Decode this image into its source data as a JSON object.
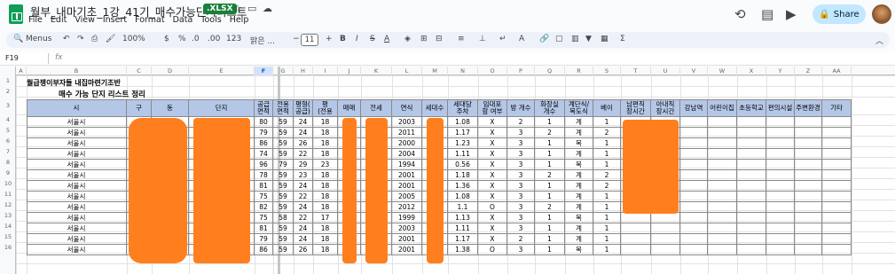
{
  "app": {
    "doc_title": "월부_내마기초_1강_41기_매수가능단지리스트",
    "file_badge": ".XLSX",
    "menu": [
      "File",
      "Edit",
      "View",
      "Insert",
      "Format",
      "Data",
      "Tools",
      "Help"
    ],
    "share_label": "Share"
  },
  "toolbar": {
    "menus_label": "Menus",
    "zoom": "100%",
    "currency": "$",
    "percent": "%",
    "dec_decrease": ".0",
    "dec_increase": ".00",
    "number_format": "123",
    "font_name": "맑은 ...",
    "font_size": "11",
    "bold": "B",
    "italic": "I",
    "strike": "S",
    "text_color": "A"
  },
  "formula_bar": {
    "name_box": "F19",
    "fx": "fx",
    "value": ""
  },
  "grid": {
    "selected_col": "F",
    "columns": [
      "A",
      "B",
      "C",
      "D",
      "E",
      "F",
      "G",
      "H",
      "I",
      "J",
      "K",
      "L",
      "M",
      "N",
      "O",
      "P",
      "Q",
      "R",
      "S",
      "T",
      "U",
      "V",
      "W",
      "X",
      "Y",
      "Z",
      "AA"
    ],
    "row_numbers": [
      "1",
      "2",
      "3",
      "4",
      "5",
      "6",
      "7",
      "8",
      "9",
      "10",
      "11",
      "12",
      "13",
      "14",
      "15",
      "16"
    ],
    "title1": "월급쟁이부자들 내집마련기조반",
    "title2": "매수 가능 단지 리스트 정리",
    "headers": [
      "시",
      "구",
      "동",
      "단지",
      "공급\n면적",
      "전용\n면적",
      "평형(\n공급)",
      "평\n(전용",
      "매매",
      "전세",
      "연식",
      "세대수",
      "세대당\n주차",
      "임대포\n함 여부",
      "방 개수",
      "화장실\n개수",
      "계단식/\n복도식",
      "베이",
      "남편직\n장시간",
      "아내직\n장시간",
      "강남역",
      "어린이집",
      "초등학교",
      "편의시설",
      "주변환경",
      "기타"
    ],
    "rows": [
      {
        "si": "서울시",
        "supply": "80",
        "exclusive": "59",
        "pyeong": "24",
        "pyeong_ex": "18",
        "year": "2003",
        "parking": "1.08",
        "rental": "X",
        "rooms": "2",
        "baths": "1",
        "type": "계",
        "bay": "1"
      },
      {
        "si": "서울시",
        "supply": "79",
        "exclusive": "59",
        "pyeong": "24",
        "pyeong_ex": "18",
        "year": "2011",
        "parking": "1.17",
        "rental": "X",
        "rooms": "3",
        "baths": "2",
        "type": "계",
        "bay": "2"
      },
      {
        "si": "서울시",
        "supply": "86",
        "exclusive": "59",
        "pyeong": "26",
        "pyeong_ex": "18",
        "year": "2000",
        "parking": "1.23",
        "rental": "X",
        "rooms": "3",
        "baths": "1",
        "type": "복",
        "bay": "1"
      },
      {
        "si": "서울시",
        "supply": "74",
        "exclusive": "59",
        "pyeong": "22",
        "pyeong_ex": "18",
        "year": "2004",
        "parking": "1.11",
        "rental": "X",
        "rooms": "3",
        "baths": "1",
        "type": "계",
        "bay": "1"
      },
      {
        "si": "서울시",
        "supply": "96",
        "exclusive": "79",
        "pyeong": "29",
        "pyeong_ex": "23",
        "year": "1994",
        "parking": "0.56",
        "rental": "X",
        "rooms": "3",
        "baths": "1",
        "type": "복",
        "bay": "1"
      },
      {
        "si": "서울시",
        "supply": "78",
        "exclusive": "59",
        "pyeong": "23",
        "pyeong_ex": "18",
        "year": "2001",
        "parking": "1.18",
        "rental": "X",
        "rooms": "3",
        "baths": "2",
        "type": "계",
        "bay": "2"
      },
      {
        "si": "서울시",
        "supply": "81",
        "exclusive": "59",
        "pyeong": "24",
        "pyeong_ex": "18",
        "year": "2001",
        "parking": "1.36",
        "rental": "X",
        "rooms": "3",
        "baths": "1",
        "type": "계",
        "bay": "2"
      },
      {
        "si": "서울시",
        "supply": "75",
        "exclusive": "59",
        "pyeong": "22",
        "pyeong_ex": "18",
        "year": "2005",
        "parking": "1.08",
        "rental": "X",
        "rooms": "3",
        "baths": "1",
        "type": "계",
        "bay": "1"
      },
      {
        "si": "서울시",
        "supply": "82",
        "exclusive": "59",
        "pyeong": "24",
        "pyeong_ex": "18",
        "year": "2012",
        "parking": "1.1",
        "rental": "O",
        "rooms": "3",
        "baths": "2",
        "type": "계",
        "bay": "1"
      },
      {
        "si": "서울시",
        "supply": "75",
        "exclusive": "58",
        "pyeong": "22",
        "pyeong_ex": "17",
        "year": "1999",
        "parking": "1.13",
        "rental": "X",
        "rooms": "3",
        "baths": "1",
        "type": "복",
        "bay": "1"
      },
      {
        "si": "서울시",
        "supply": "81",
        "exclusive": "59",
        "pyeong": "24",
        "pyeong_ex": "18",
        "year": "2003",
        "parking": "1.11",
        "rental": "X",
        "rooms": "3",
        "baths": "1",
        "type": "계",
        "bay": "1"
      },
      {
        "si": "서울시",
        "supply": "79",
        "exclusive": "59",
        "pyeong": "24",
        "pyeong_ex": "18",
        "year": "2001",
        "parking": "1.17",
        "rental": "X",
        "rooms": "2",
        "baths": "1",
        "type": "계",
        "bay": "1"
      },
      {
        "si": "서울시",
        "supply": "86",
        "exclusive": "59",
        "pyeong": "26",
        "pyeong_ex": "18",
        "year": "2001",
        "parking": "1.38",
        "rental": "O",
        "rooms": "3",
        "baths": "1",
        "type": "복",
        "bay": "1"
      }
    ]
  },
  "colors": {
    "header_fill": "#b4c7e7",
    "redaction": "#ff7f1f",
    "share_bg": "#c2e7ff",
    "sheets_green": "#0f9d58"
  }
}
